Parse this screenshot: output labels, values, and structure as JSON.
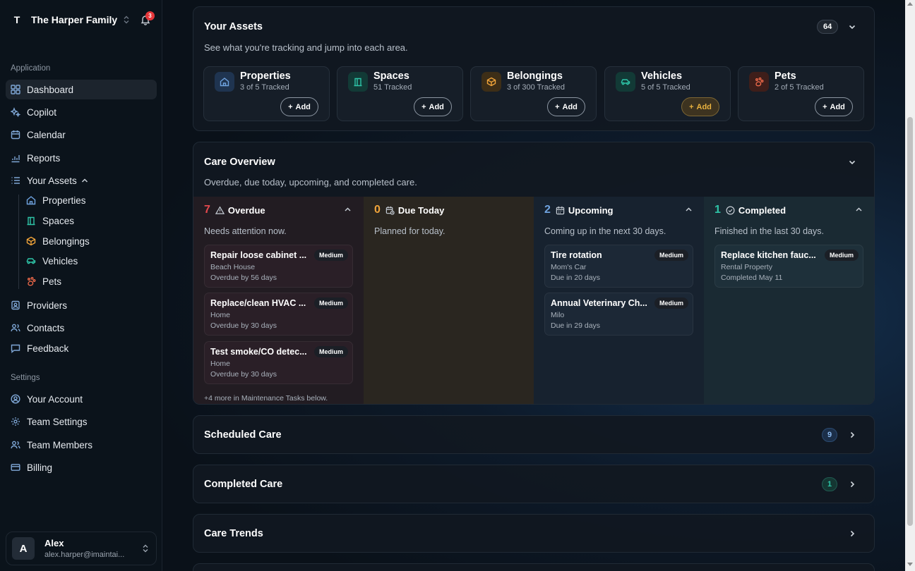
{
  "sidebar": {
    "team_initial": "T",
    "team_name": "The Harper Family",
    "notification_count": "3",
    "application_label": "Application",
    "settings_label": "Settings",
    "nav": {
      "dashboard": "Dashboard",
      "copilot": "Copilot",
      "calendar": "Calendar",
      "reports": "Reports",
      "your_assets": "Your Assets",
      "properties": "Properties",
      "spaces": "Spaces",
      "belongings": "Belongings",
      "vehicles": "Vehicles",
      "pets": "Pets",
      "providers": "Providers",
      "contacts": "Contacts",
      "feedback": "Feedback",
      "your_account": "Your Account",
      "team_settings": "Team Settings",
      "team_members": "Team Members",
      "billing": "Billing"
    },
    "user": {
      "initial": "A",
      "name": "Alex",
      "email": "alex.harper@imaintai..."
    }
  },
  "assets": {
    "title": "Your Assets",
    "subtitle": "See what you're tracking and jump into each area.",
    "count": "64",
    "add_label": "Add",
    "items": [
      {
        "name": "Properties",
        "count": "3 of 5 Tracked",
        "icon": "home-icon",
        "color": "#6fa3e0"
      },
      {
        "name": "Spaces",
        "count": "51 Tracked",
        "icon": "door-icon",
        "color": "#2ec4a7"
      },
      {
        "name": "Belongings",
        "count": "3 of 300 Tracked",
        "icon": "box-icon",
        "color": "#f0a43a"
      },
      {
        "name": "Vehicles",
        "count": "5 of 5 Tracked",
        "icon": "car-icon",
        "color": "#2ec4a7"
      },
      {
        "name": "Pets",
        "count": "2 of 5 Tracked",
        "icon": "paw-icon",
        "color": "#f06a4a"
      }
    ]
  },
  "care_overview": {
    "title": "Care Overview",
    "subtitle": "Overdue, due today, upcoming, and completed care.",
    "columns": {
      "overdue": {
        "count": "7",
        "label": "Overdue",
        "subtitle": "Needs attention now.",
        "more": "+4 more in Maintenance Tasks below.",
        "tasks": [
          {
            "title": "Repair loose cabinet ...",
            "badge": "Medium",
            "place": "Beach House",
            "status": "Overdue by 56 days"
          },
          {
            "title": "Replace/clean HVAC ...",
            "badge": "Medium",
            "place": "Home",
            "status": "Overdue by 30 days"
          },
          {
            "title": "Test smoke/CO detec...",
            "badge": "Medium",
            "place": "Home",
            "status": "Overdue by 30 days"
          }
        ]
      },
      "due_today": {
        "count": "0",
        "label": "Due Today",
        "subtitle": "Planned for today."
      },
      "upcoming": {
        "count": "2",
        "label": "Upcoming",
        "subtitle": "Coming up in the next 30 days.",
        "tasks": [
          {
            "title": "Tire rotation",
            "badge": "Medium",
            "place": "Mom's Car",
            "status": "Due in 20 days"
          },
          {
            "title": "Annual Veterinary Ch...",
            "badge": "Medium",
            "place": "Milo",
            "status": "Due in 29 days"
          }
        ]
      },
      "completed": {
        "count": "1",
        "label": "Completed",
        "subtitle": "Finished in the last 30 days.",
        "tasks": [
          {
            "title": "Replace kitchen fauc...",
            "badge": "Medium",
            "place": "Rental Property",
            "status": "Completed May 11"
          }
        ]
      }
    }
  },
  "sections": {
    "scheduled": {
      "title": "Scheduled Care",
      "count": "9"
    },
    "completed": {
      "title": "Completed Care",
      "count": "1"
    },
    "trends": {
      "title": "Care Trends"
    }
  },
  "colors": {
    "overdue": "#e5484d",
    "due_today": "#f0a43a",
    "upcoming": "#6fa3e0",
    "completed": "#2ec4a7"
  }
}
